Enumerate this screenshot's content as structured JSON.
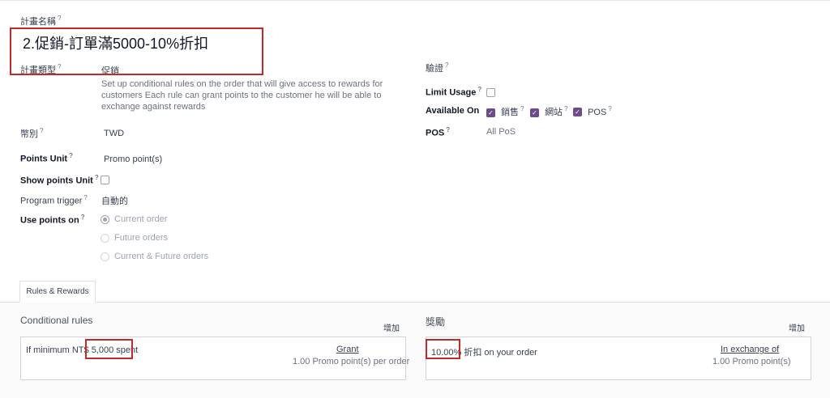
{
  "form": {
    "program_name_label": "計畫名稱",
    "program_name": "2.促銷-訂單滿5000-10%折扣",
    "program_type_label": "計畫類型",
    "program_type": "促銷",
    "program_type_desc": "Set up conditional rules on the order that will give access to rewards for customers Each rule can grant points to the customer he will be able to exchange against rewards",
    "currency_label": "幣別",
    "currency": "TWD",
    "points_unit_label": "Points Unit",
    "points_unit": "Promo point(s)",
    "show_points_unit_label": "Show points Unit",
    "program_trigger_label": "Program trigger",
    "program_trigger": "自動的",
    "use_points_on_label": "Use points on",
    "use_points_options": [
      "Current order",
      "Future orders",
      "Current & Future orders"
    ],
    "validity_label": "驗證",
    "limit_usage_label": "Limit Usage",
    "available_on_label": "Available On",
    "available_on": [
      "銷售",
      "網站",
      "POS"
    ],
    "pos_label": "POS",
    "pos_value": "All PoS",
    "help_mark": "?"
  },
  "tabs": {
    "rules_rewards": "Rules & Rewards"
  },
  "rules": {
    "title": "Conditional rules",
    "add": "增加",
    "rule_text_prefix": "If minimum NT$ ",
    "rule_text_amount": "5,000 spent",
    "grant_label": "Grant",
    "grant_value": "1.00 Promo point(s) per order"
  },
  "rewards": {
    "title": "獎勵",
    "add": "增加",
    "reward_amount": "10.00%",
    "reward_text": " 折扣 on your order",
    "exchange_label": "In exchange of",
    "exchange_value": "1.00 Promo point(s)"
  },
  "colors": {
    "highlight_box": "#c62828",
    "checkbox_checked": "#6d4c8a"
  }
}
